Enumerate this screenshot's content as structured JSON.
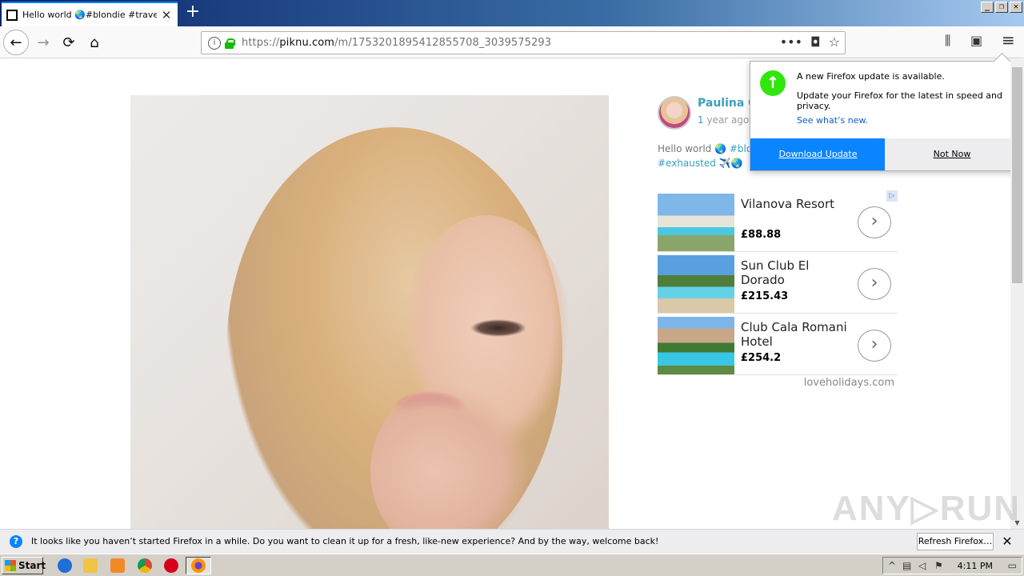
{
  "browser": {
    "tab_title": "Hello world 🌏#blondie #travel #n",
    "url_prefix": "https://",
    "url_host": "piknu.com",
    "url_path": "/m/1753201895412855708_3039575293"
  },
  "icons": {
    "back": "←",
    "forward": "→",
    "reload": "⟳",
    "home": "⌂",
    "more": "•••",
    "pocket": "◘",
    "star": "☆",
    "library": "⫼",
    "sidebar": "▣",
    "menu": "≡",
    "tab_close": "✕",
    "new_tab": "+",
    "min": "_",
    "max": "❐",
    "close": "✕"
  },
  "post": {
    "author_name": "Paulina C",
    "time_number": "1",
    "time_rest": " year ago",
    "caption_prefix": "Hello world 🌏 ",
    "caption_tag1": "#blon",
    "caption_tag2": "#exhausted ✈️🌏"
  },
  "ads": {
    "items": [
      {
        "name": "Vilanova Resort",
        "price": "£88.88"
      },
      {
        "name": "Sun Club El Dorado",
        "price": "£215.43"
      },
      {
        "name": "Club Cala Romani Hotel",
        "price": "£254.2"
      }
    ],
    "source": "loveholidays.com",
    "arrow": "›",
    "adchoices": "▷"
  },
  "update_popup": {
    "title": "A new Firefox update is available.",
    "description": "Update your Firefox for the latest in speed and privacy.",
    "link": "See what’s new.",
    "primary_label": "Download Update",
    "secondary_label": "Not Now",
    "icon": "↑"
  },
  "notification": {
    "text": "It looks like you haven’t started Firefox in a while. Do you want to clean it up for a fresh, like-new experience? And by the way, welcome back!",
    "button_label": "Refresh Firefox…",
    "icon": "?",
    "close": "✕"
  },
  "watermark": "ANY▷RUN",
  "taskbar": {
    "start_label": "Start",
    "clock": "4:11 PM"
  },
  "colors": {
    "accent": "#0a84ff",
    "link": "#3a9fc1",
    "update_green": "#30e60b"
  }
}
